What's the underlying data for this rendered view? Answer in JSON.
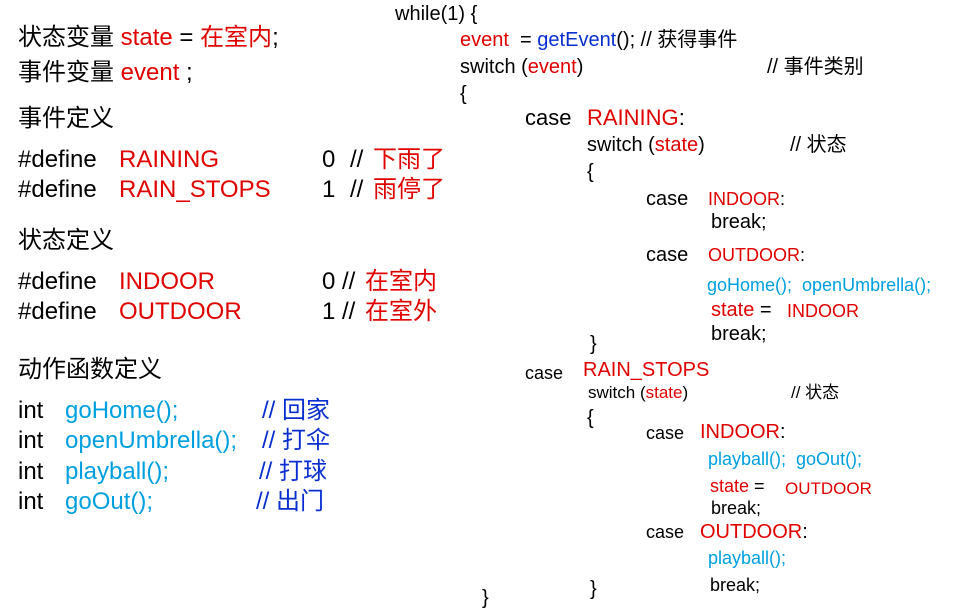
{
  "left": {
    "line1": {
      "pre": "状态变量 ",
      "var": "state",
      "eq": " = ",
      "val": "在室内",
      "end": ";"
    },
    "line2": {
      "pre": "事件变量 ",
      "var": "event",
      "end": " ;"
    },
    "event_def_heading": "事件定义",
    "events": [
      {
        "kw": "#define",
        "name": "RAINING",
        "num": "0",
        "slash": "//",
        "comment": "下雨了"
      },
      {
        "kw": "#define",
        "name": "RAIN_STOPS",
        "num": "1",
        "slash": "//",
        "comment": "雨停了"
      }
    ],
    "state_def_heading": "状态定义",
    "states": [
      {
        "kw": "#define",
        "name": "INDOOR",
        "num": "0",
        "slash": "//",
        "comment": "在室内"
      },
      {
        "kw": "#define",
        "name": "OUTDOOR",
        "num": "1",
        "slash": "//",
        "comment": "在室外"
      }
    ],
    "action_def_heading": "动作函数定义",
    "actions": [
      {
        "type": "int",
        "name": "goHome();",
        "comment": "// 回家"
      },
      {
        "type": "int",
        "name": "openUmbrella();",
        "comment": "// 打伞"
      },
      {
        "type": "int",
        "name": "playball();",
        "comment": "// 打球"
      },
      {
        "type": "int",
        "name": "goOut();",
        "comment": "// 出门"
      }
    ]
  },
  "right": {
    "while": "while(1) {",
    "event_assign": {
      "var": "event",
      "eq": "  = ",
      "fn": "getEvent",
      "rest": "(); // 获得事件"
    },
    "switch_event": {
      "kw": "switch (",
      "var": "event",
      "close": ")",
      "comment": "// 事件类别"
    },
    "brace_open": "{",
    "case_raining": {
      "kw": "case",
      "name": "RAINING",
      "colon": ":"
    },
    "switch_state1": {
      "kw": "switch (",
      "var": "state",
      "close": ")",
      "comment": "// 状态"
    },
    "brace_open2": "{",
    "case_indoor1": {
      "kw": "case",
      "name": "INDOOR",
      "colon": ":"
    },
    "break1": "break;",
    "case_outdoor1": {
      "kw": "case",
      "name": "OUTDOOR",
      "colon": ":"
    },
    "actions1": "goHome();  openUmbrella();",
    "state_assign1": {
      "var": "state",
      "eq": " = ",
      "val": "INDOOR"
    },
    "break2": "break;",
    "brace_close1": "}",
    "case_rainstops": {
      "kw": "case",
      "name": "RAIN_STOPS"
    },
    "switch_state2": {
      "kw": "switch (",
      "var": "state",
      "close": ")",
      "comment": "// 状态"
    },
    "brace_open3": "{",
    "case_indoor2": {
      "kw": "case",
      "name": "INDOOR",
      "colon": ":"
    },
    "actions2": "playball();  goOut();",
    "state_assign2": {
      "var": "state",
      "eq": " = ",
      "val": "OUTDOOR"
    },
    "break3": "break;",
    "case_outdoor2": {
      "kw": "case",
      "name": "OUTDOOR",
      "colon": ":"
    },
    "actions3": "playball();",
    "break4": "break;",
    "brace_close2": "}",
    "brace_close3": "}"
  },
  "colors": {
    "red": "#e00000",
    "blue": "#0a2fd0",
    "cyan": "#00a0e0"
  }
}
